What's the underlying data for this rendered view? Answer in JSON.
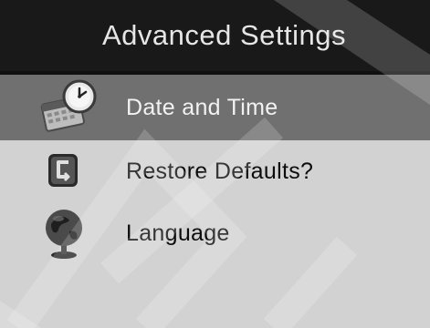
{
  "header": {
    "title": "Advanced Settings"
  },
  "menu": {
    "items": [
      {
        "label": "Date and Time",
        "icon": "calendar-clock-icon",
        "selected": true
      },
      {
        "label": "Restore Defaults?",
        "icon": "restore-icon",
        "selected": false
      },
      {
        "label": "Language",
        "icon": "globe-icon",
        "selected": false
      }
    ]
  },
  "colors": {
    "header_bg": "#191919",
    "menu_bg": "#d2d2d2",
    "selected_bg": "#707070"
  }
}
